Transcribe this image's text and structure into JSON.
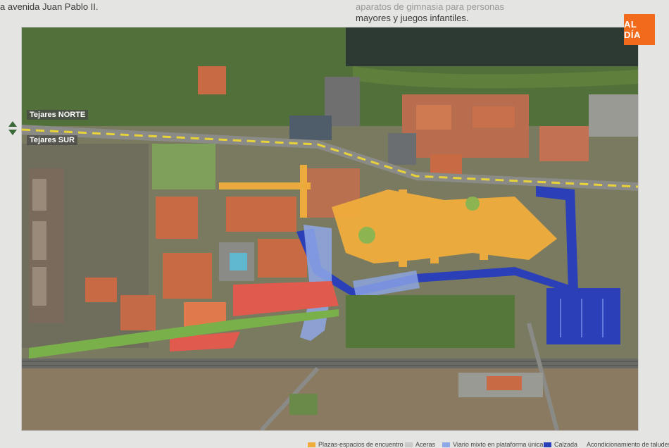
{
  "header": {
    "left_text": "a avenida Juan Pablo II.",
    "right_text_line1": "aparatos de gimnasia para personas",
    "right_text_line2": "mayores y juegos infantiles."
  },
  "badge": {
    "text": "AL DÍA",
    "color": "#f26a1b"
  },
  "map": {
    "labels": {
      "north": "Tejares NORTE",
      "south": "Tejares SUR"
    },
    "colors": {
      "plazas": "#f0ad3c",
      "aceras": "#c9c9c9",
      "viario_mixto": "#8fa8e6",
      "calzada": "#2a3fb8",
      "taludes": "#e05a4e",
      "greenery": "#5d7d3a",
      "roofs": "#c86a44"
    }
  },
  "legend": {
    "items": [
      {
        "label": "Plazas-espacios de encuentro",
        "color": "#f0ad3c"
      },
      {
        "label": "Aceras",
        "color": "#c9c9c9"
      },
      {
        "label": "Viario mixto en plataforma única",
        "color": "#8fa8e6"
      },
      {
        "label": "Calzada",
        "color": "#2a3fb8"
      },
      {
        "label": "Acondicionamiento de taludes",
        "color": "#e05a4e"
      }
    ]
  }
}
